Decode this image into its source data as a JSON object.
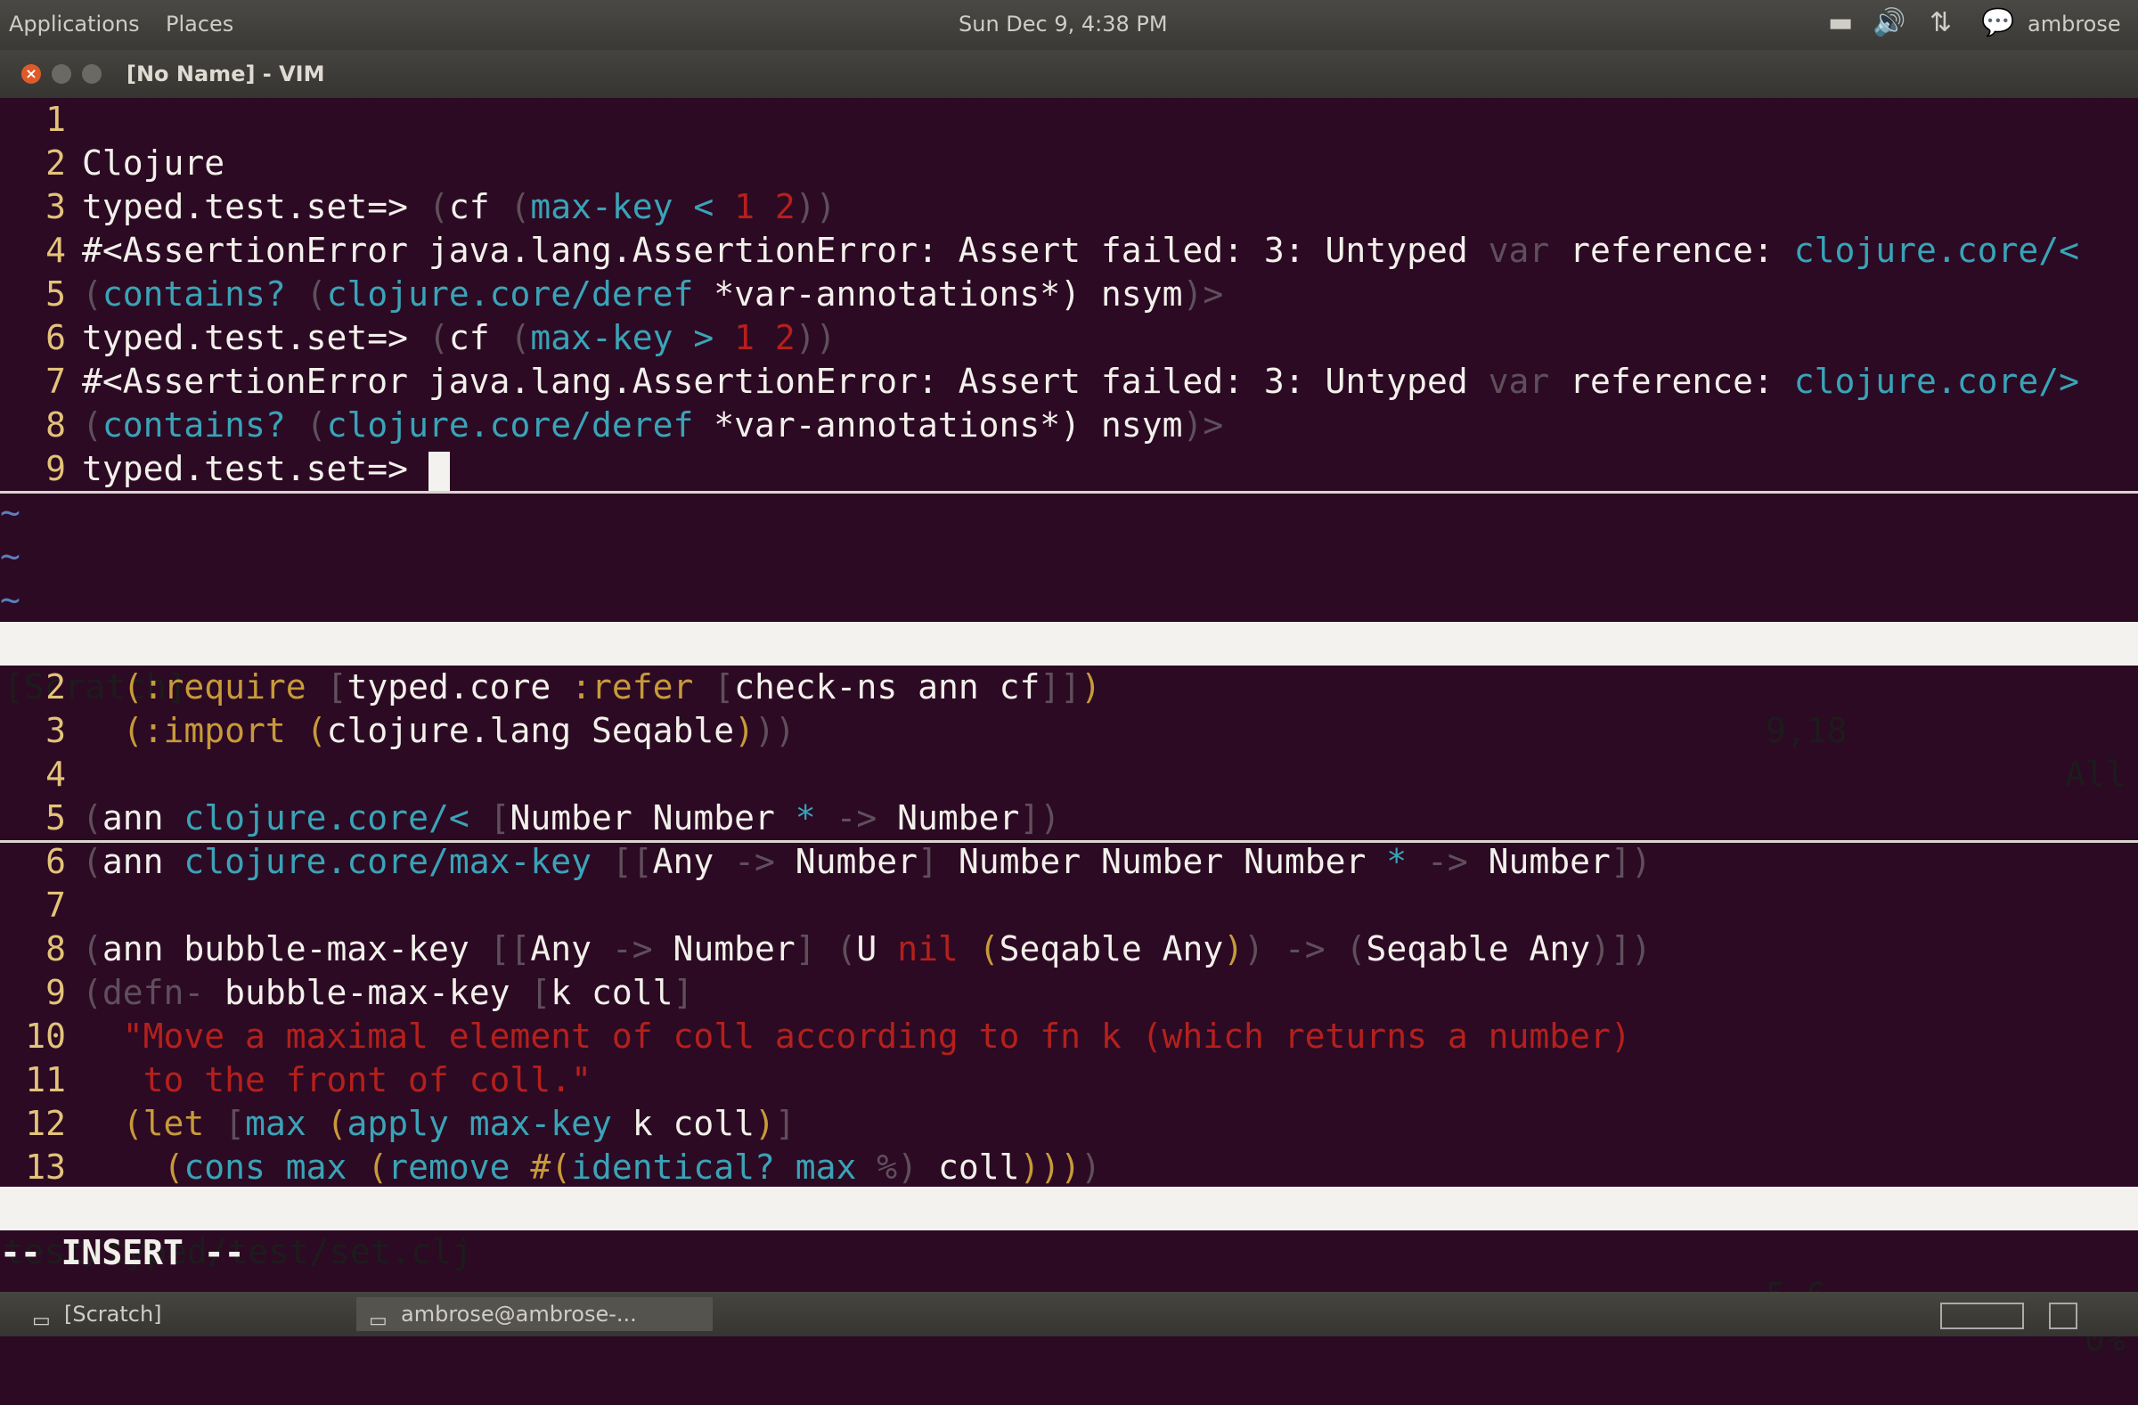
{
  "top_panel": {
    "menu": [
      "Applications",
      "Places"
    ],
    "clock": "Sun Dec  9,  4:38 PM",
    "tray_icons": [
      "battery-icon",
      "volume-icon",
      "network-icon",
      "chat-icon"
    ],
    "user": "ambrose"
  },
  "window": {
    "title": "[No Name] - VIM"
  },
  "scratch_lines": [
    {
      "num": "1",
      "segments": []
    },
    {
      "num": "2",
      "segments": [
        {
          "t": "Clojure",
          "c": ""
        }
      ]
    },
    {
      "num": "3",
      "segments": [
        {
          "t": "typed.test.set=> ",
          "c": ""
        },
        {
          "t": "(",
          "c": "paren"
        },
        {
          "t": "cf ",
          "c": ""
        },
        {
          "t": "(",
          "c": "paren"
        },
        {
          "t": "max-key",
          "c": "cyan"
        },
        {
          "t": " < ",
          "c": "cyan"
        },
        {
          "t": "1 2",
          "c": "red"
        },
        {
          "t": "))",
          "c": "paren"
        }
      ]
    },
    {
      "num": "4",
      "segments": [
        {
          "t": "#<AssertionError java.lang.AssertionError: Assert failed: 3: Untyped ",
          "c": ""
        },
        {
          "t": "var",
          "c": "paren"
        },
        {
          "t": " reference: ",
          "c": ""
        },
        {
          "t": "clojure.core/<",
          "c": "cyan"
        }
      ]
    },
    {
      "num": "5",
      "segments": [
        {
          "t": "(",
          "c": "paren"
        },
        {
          "t": "contains? ",
          "c": "cyan"
        },
        {
          "t": "(",
          "c": "paren"
        },
        {
          "t": "clojure.core/deref",
          "c": "cyan"
        },
        {
          "t": " *var-annotations*) nsym",
          "c": ""
        },
        {
          "t": ")>",
          "c": "paren"
        }
      ]
    },
    {
      "num": "6",
      "segments": [
        {
          "t": "typed.test.set=> ",
          "c": ""
        },
        {
          "t": "(",
          "c": "paren"
        },
        {
          "t": "cf ",
          "c": ""
        },
        {
          "t": "(",
          "c": "paren"
        },
        {
          "t": "max-key",
          "c": "cyan"
        },
        {
          "t": " > ",
          "c": "cyan"
        },
        {
          "t": "1 2",
          "c": "red"
        },
        {
          "t": "))",
          "c": "paren"
        }
      ]
    },
    {
      "num": "7",
      "segments": [
        {
          "t": "#<AssertionError java.lang.AssertionError: Assert failed: 3: Untyped ",
          "c": ""
        },
        {
          "t": "var",
          "c": "paren"
        },
        {
          "t": " reference: ",
          "c": ""
        },
        {
          "t": "clojure.core/>",
          "c": "cyan"
        }
      ]
    },
    {
      "num": "8",
      "segments": [
        {
          "t": "(",
          "c": "paren"
        },
        {
          "t": "contains? ",
          "c": "cyan"
        },
        {
          "t": "(",
          "c": "paren"
        },
        {
          "t": "clojure.core/deref",
          "c": "cyan"
        },
        {
          "t": " *var-annotations*) nsym",
          "c": ""
        },
        {
          "t": ")>",
          "c": "paren"
        }
      ]
    },
    {
      "num": "9",
      "segments": [
        {
          "t": "typed.test.set=> ",
          "c": ""
        }
      ]
    }
  ],
  "tildes": [
    "~",
    "~",
    "~"
  ],
  "scratch_status": {
    "name": "[Scratch]",
    "position": "9,18",
    "scroll": "All"
  },
  "file_lines": [
    {
      "num": "2",
      "segments": [
        {
          "t": "  ",
          "c": ""
        },
        {
          "t": "(",
          "c": "kw"
        },
        {
          "t": ":require ",
          "c": "kw"
        },
        {
          "t": "[",
          "c": "paren"
        },
        {
          "t": "typed.core ",
          "c": ""
        },
        {
          "t": ":refer ",
          "c": "kw"
        },
        {
          "t": "[",
          "c": "paren"
        },
        {
          "t": "check-ns ann cf",
          "c": ""
        },
        {
          "t": "]]",
          "c": "paren"
        },
        {
          "t": ")",
          "c": "kw"
        }
      ]
    },
    {
      "num": "3",
      "segments": [
        {
          "t": "  ",
          "c": ""
        },
        {
          "t": "(",
          "c": "kw"
        },
        {
          "t": ":import ",
          "c": "kw"
        },
        {
          "t": "(",
          "c": "kw"
        },
        {
          "t": "clojure.lang Seqable",
          "c": ""
        },
        {
          "t": ")",
          "c": "kw"
        },
        {
          "t": "))",
          "c": "paren"
        }
      ]
    },
    {
      "num": "4",
      "segments": []
    },
    {
      "num": "5",
      "segments": [
        {
          "t": "(",
          "c": "paren"
        },
        {
          "t": "ann ",
          "c": ""
        },
        {
          "t": "clojure.core/<",
          "c": "cyan"
        },
        {
          "t": " [",
          "c": "paren"
        },
        {
          "t": "Number Number ",
          "c": ""
        },
        {
          "t": "*",
          "c": "cyan"
        },
        {
          "t": " -> ",
          "c": "paren"
        },
        {
          "t": "Number",
          "c": ""
        },
        {
          "t": "])",
          "c": "paren"
        }
      ]
    },
    {
      "num": "6",
      "segments": [
        {
          "t": "(",
          "c": "paren"
        },
        {
          "t": "ann ",
          "c": ""
        },
        {
          "t": "clojure.core/max-key",
          "c": "cyan"
        },
        {
          "t": " [[",
          "c": "paren"
        },
        {
          "t": "Any ",
          "c": ""
        },
        {
          "t": "-> ",
          "c": "paren"
        },
        {
          "t": "Number",
          "c": ""
        },
        {
          "t": "] ",
          "c": "paren"
        },
        {
          "t": "Number Number Number ",
          "c": ""
        },
        {
          "t": "*",
          "c": "cyan"
        },
        {
          "t": " -> ",
          "c": "paren"
        },
        {
          "t": "Number",
          "c": ""
        },
        {
          "t": "])",
          "c": "paren"
        }
      ]
    },
    {
      "num": "7",
      "segments": []
    },
    {
      "num": "8",
      "segments": [
        {
          "t": "(",
          "c": "paren"
        },
        {
          "t": "ann bubble-max-key ",
          "c": ""
        },
        {
          "t": "[[",
          "c": "paren"
        },
        {
          "t": "Any ",
          "c": ""
        },
        {
          "t": "-> ",
          "c": "paren"
        },
        {
          "t": "Number",
          "c": ""
        },
        {
          "t": "] (",
          "c": "paren"
        },
        {
          "t": "U ",
          "c": ""
        },
        {
          "t": "nil",
          "c": "red"
        },
        {
          "t": " (",
          "c": "kw"
        },
        {
          "t": "Seqable Any",
          "c": ""
        },
        {
          "t": ")",
          "c": "kw"
        },
        {
          "t": ")",
          "c": "paren"
        },
        {
          "t": " -> ",
          "c": "paren"
        },
        {
          "t": "(",
          "c": "paren"
        },
        {
          "t": "Seqable Any",
          "c": ""
        },
        {
          "t": ")])",
          "c": "paren"
        }
      ]
    },
    {
      "num": "9",
      "segments": [
        {
          "t": "(",
          "c": "paren"
        },
        {
          "t": "defn- ",
          "c": "paren"
        },
        {
          "t": "bubble-max-key ",
          "c": ""
        },
        {
          "t": "[",
          "c": "paren"
        },
        {
          "t": "k coll",
          "c": ""
        },
        {
          "t": "]",
          "c": "paren"
        }
      ]
    },
    {
      "num": "10",
      "segments": [
        {
          "t": "  \"Move a maximal element of coll according to fn k (which returns a number)",
          "c": "red"
        }
      ]
    },
    {
      "num": "11",
      "segments": [
        {
          "t": "   to the front of coll.\"",
          "c": "red"
        }
      ]
    },
    {
      "num": "12",
      "segments": [
        {
          "t": "  ",
          "c": ""
        },
        {
          "t": "(",
          "c": "kw"
        },
        {
          "t": "let ",
          "c": "kw"
        },
        {
          "t": "[",
          "c": "paren"
        },
        {
          "t": "max ",
          "c": "cyan"
        },
        {
          "t": "(",
          "c": "kw"
        },
        {
          "t": "apply max-key",
          "c": "cyan"
        },
        {
          "t": " k coll",
          "c": ""
        },
        {
          "t": ")",
          "c": "kw"
        },
        {
          "t": "]",
          "c": "paren"
        }
      ]
    },
    {
      "num": "13",
      "segments": [
        {
          "t": "    ",
          "c": ""
        },
        {
          "t": "(",
          "c": "kw"
        },
        {
          "t": "cons max ",
          "c": "cyan"
        },
        {
          "t": "(",
          "c": "kw"
        },
        {
          "t": "remove ",
          "c": "cyan"
        },
        {
          "t": "#(",
          "c": "kw"
        },
        {
          "t": "identical? max ",
          "c": "cyan"
        },
        {
          "t": "%",
          "c": "paren"
        },
        {
          "t": ") ",
          "c": "paren"
        },
        {
          "t": "coll",
          "c": ""
        },
        {
          "t": ")))",
          "c": "kw"
        },
        {
          "t": ")",
          "c": "paren"
        }
      ]
    }
  ],
  "file_status": {
    "name": "test/typed/test/set.clj",
    "position": "5,6",
    "scroll": "0%"
  },
  "mode": "-- INSERT --",
  "taskbar": {
    "tasks": [
      {
        "label": "[Scratch]",
        "icon": "window-icon"
      },
      {
        "label": "ambrose@ambrose-...",
        "icon": "terminal-icon"
      }
    ]
  },
  "colors": {
    "background": "#2c0a23",
    "cyan": "#3aa3b7",
    "red": "#b4201c",
    "linenr": "#e3c37a",
    "keyword": "#c79a3a"
  }
}
